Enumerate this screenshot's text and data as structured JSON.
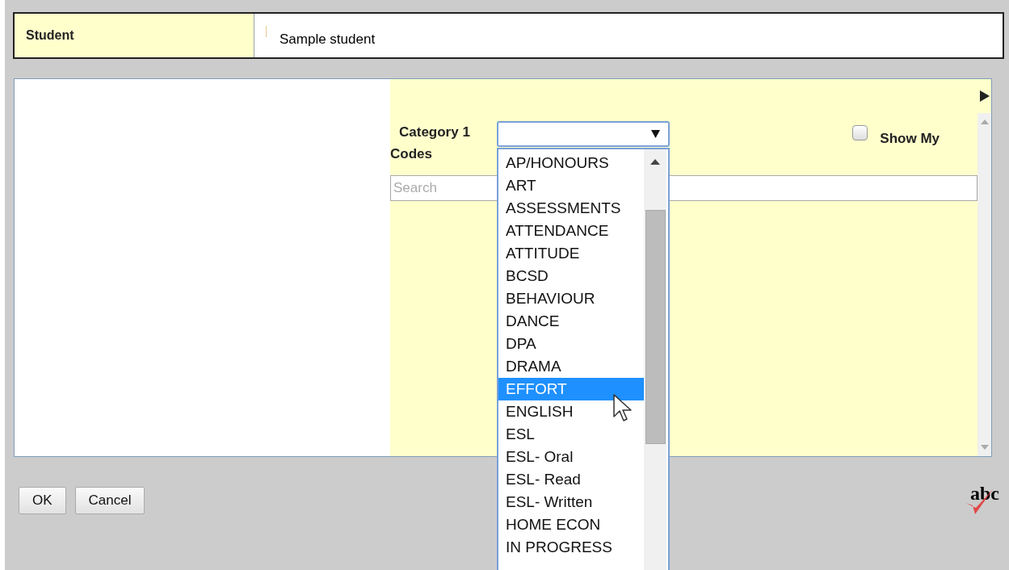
{
  "student_field": {
    "label": "Student",
    "value": "Sample student"
  },
  "panel": {
    "category_label": "Category 1",
    "codes_label": "Codes",
    "category_select": {
      "expanded": true
    },
    "show_my": {
      "label": "Show My",
      "checked": false
    },
    "search": {
      "placeholder": "Search"
    }
  },
  "dropdown_options": [
    {
      "label": "AP/HONOURS",
      "selected": false
    },
    {
      "label": "ART",
      "selected": false
    },
    {
      "label": "ASSESSMENTS",
      "selected": false
    },
    {
      "label": "ATTENDANCE",
      "selected": false
    },
    {
      "label": "ATTITUDE",
      "selected": false
    },
    {
      "label": "BCSD",
      "selected": false
    },
    {
      "label": "BEHAVIOUR",
      "selected": false
    },
    {
      "label": "DANCE",
      "selected": false
    },
    {
      "label": "DPA",
      "selected": false
    },
    {
      "label": "DRAMA",
      "selected": false
    },
    {
      "label": "EFFORT",
      "selected": true
    },
    {
      "label": "ENGLISH",
      "selected": false
    },
    {
      "label": "ESL",
      "selected": false
    },
    {
      "label": "ESL- Oral",
      "selected": false
    },
    {
      "label": "ESL- Read",
      "selected": false
    },
    {
      "label": "ESL- Written",
      "selected": false
    },
    {
      "label": "HOME ECON",
      "selected": false
    },
    {
      "label": "IN PROGRESS",
      "selected": false
    }
  ],
  "buttons": [
    "OK",
    "Cancel"
  ],
  "spellcheck_label": "abc"
}
